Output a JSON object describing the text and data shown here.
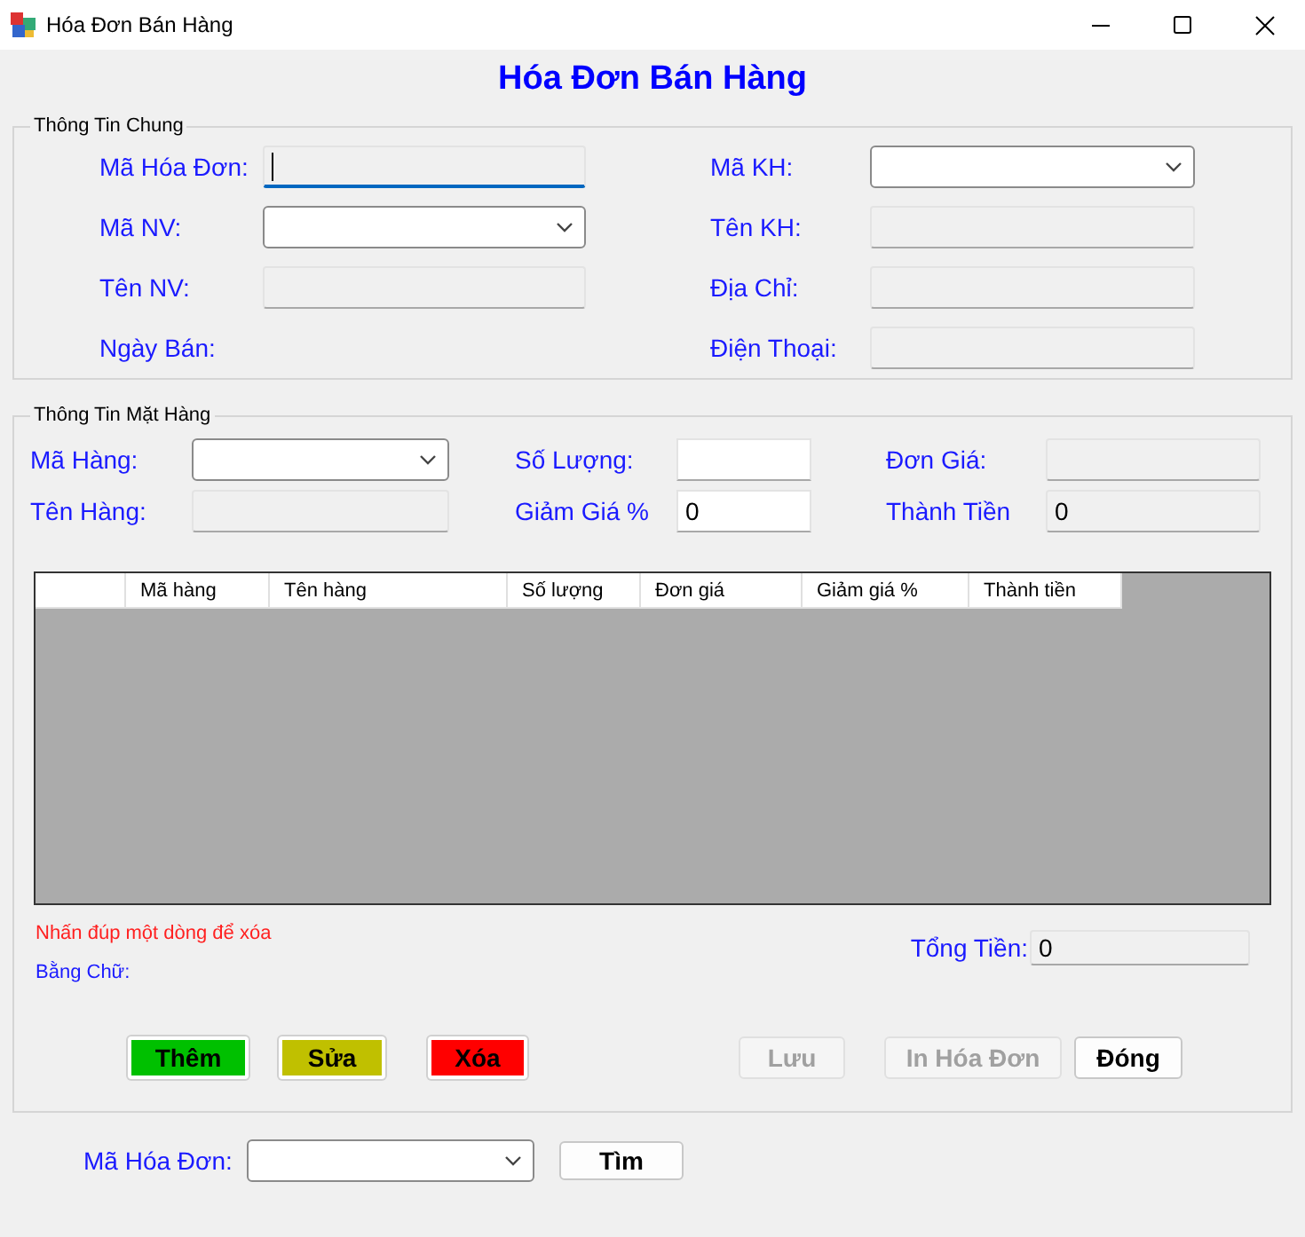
{
  "window": {
    "title": "Hóa Đơn Bán Hàng"
  },
  "heading": "Hóa Đơn Bán Hàng",
  "general_info": {
    "title": "Thông Tin Chung",
    "left_fields": [
      {
        "label": "Mã Hóa Đơn:",
        "kind": "readonly",
        "focused": true
      },
      {
        "label": "Mã NV:",
        "kind": "combo",
        "focused": false
      },
      {
        "label": "Tên NV:",
        "kind": "readonly",
        "focused": false
      },
      {
        "label": "Ngày Bán:",
        "kind": "none",
        "focused": false
      }
    ],
    "right_fields": [
      {
        "label": "Mã KH:",
        "kind": "combo",
        "focused": false
      },
      {
        "label": "Tên KH:",
        "kind": "readonly",
        "focused": false
      },
      {
        "label": "Địa Chỉ:",
        "kind": "readonly",
        "focused": false
      },
      {
        "label": "Điện Thoại:",
        "kind": "readonly",
        "focused": false
      }
    ]
  },
  "item_info": {
    "title": "Thông Tin Mặt Hàng",
    "fields": [
      {
        "label": "Mã Hàng:",
        "kind": "combo"
      },
      {
        "label": "Số Lượng:",
        "kind": "textbox"
      },
      {
        "label": "Đơn Giá:",
        "kind": "readonly"
      },
      {
        "label": "Tên Hàng:",
        "kind": "readonly"
      },
      {
        "label": "Giảm Giá %",
        "kind": "textbox",
        "value": "0"
      },
      {
        "label": "Thành Tiền",
        "kind": "readonly",
        "value": "0"
      }
    ],
    "table": {
      "columns": [
        "Mã hàng",
        "Tên hàng",
        "Số lượng",
        "Đơn giá",
        "Giảm giá %",
        "Thành tiền"
      ]
    },
    "hint": "Nhấn đúp một dòng để xóa",
    "in_words_label": "Bằng Chữ:",
    "total": {
      "label": "Tổng Tiền:",
      "value": "0"
    },
    "buttons": [
      {
        "label": "Thêm",
        "color": "#00c000",
        "disabled": false
      },
      {
        "label": "Sửa",
        "color": "#c0c000",
        "disabled": false
      },
      {
        "label": "Xóa",
        "color": "#ff0000",
        "disabled": false
      },
      {
        "label": "Lưu",
        "disabled": true
      },
      {
        "label": "In Hóa Đơn",
        "disabled": true
      },
      {
        "label": "Đóng",
        "disabled": false
      }
    ]
  },
  "search": {
    "label": "Mã Hóa Đơn:",
    "button": "Tìm"
  }
}
